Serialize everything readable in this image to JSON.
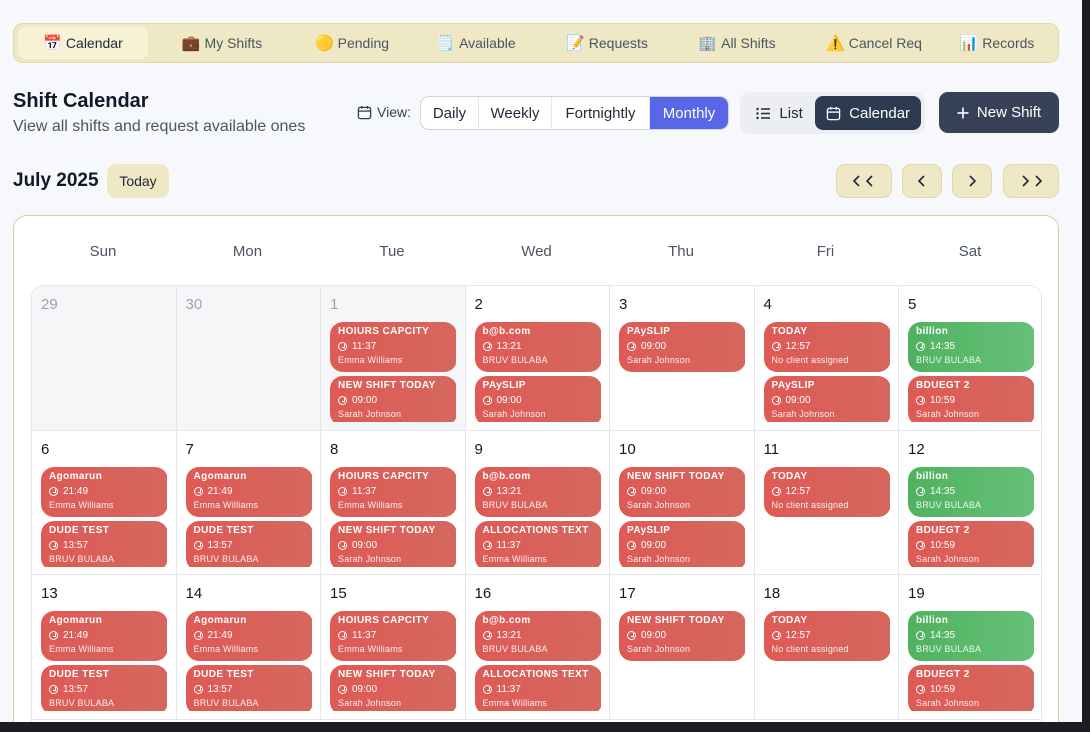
{
  "tabs": [
    {
      "icon": "📅",
      "label": "Calendar",
      "active": true
    },
    {
      "icon": "💼",
      "label": "My Shifts"
    },
    {
      "icon": "🟡",
      "label": "Pending"
    },
    {
      "icon": "🗒️",
      "label": "Available"
    },
    {
      "icon": "📝",
      "label": "Requests"
    },
    {
      "icon": "🏢",
      "label": "All Shifts"
    },
    {
      "icon": "⚠️",
      "label": "Cancel Req"
    },
    {
      "icon": "📊",
      "label": "Records"
    }
  ],
  "header": {
    "title": "Shift Calendar",
    "subtitle": "View all shifts and request available ones",
    "view_label": "View:",
    "view_options": [
      "Daily",
      "Weekly",
      "Fortnightly",
      "Monthly"
    ],
    "view_selected": "Monthly",
    "toggle": {
      "list_label": "List",
      "calendar_label": "Calendar",
      "selected": "Calendar"
    },
    "new_shift_label": "New Shift"
  },
  "month_bar": {
    "month": "July 2025",
    "today_label": "Today"
  },
  "colors": {
    "accent": "#5867e8",
    "event_red": "#de5a55",
    "event_green": "#4fb25f",
    "dark": "#374158",
    "tab_bg": "#efe8c4"
  },
  "weekdays": [
    "Sun",
    "Mon",
    "Tue",
    "Wed",
    "Thu",
    "Fri",
    "Sat"
  ],
  "weeks": [
    [
      {
        "day": "29",
        "outside": true,
        "events": []
      },
      {
        "day": "30",
        "outside": true,
        "events": []
      },
      {
        "day": "1",
        "today": true,
        "outside": true,
        "events": [
          {
            "title": "HOIURS CAPCITY",
            "time": "11:37",
            "who": "Emma Williams",
            "color": "red"
          },
          {
            "title": "NEW SHIFT TODAY",
            "time": "09:00",
            "who": "Sarah Johnson",
            "color": "red"
          }
        ]
      },
      {
        "day": "2",
        "events": [
          {
            "title": "b@b.com",
            "time": "13:21",
            "who": "BRUV BULABA",
            "color": "red"
          },
          {
            "title": "PAySLIP",
            "time": "09:00",
            "who": "Sarah Johnson",
            "color": "red"
          }
        ]
      },
      {
        "day": "3",
        "events": [
          {
            "title": "PAySLIP",
            "time": "09:00",
            "who": "Sarah Johnson",
            "color": "red"
          }
        ]
      },
      {
        "day": "4",
        "events": [
          {
            "title": "TODAY",
            "time": "12:57",
            "who": "No client assigned",
            "color": "red"
          },
          {
            "title": "PAySLIP",
            "time": "09:00",
            "who": "Sarah Johnson",
            "color": "red"
          }
        ]
      },
      {
        "day": "5",
        "events": [
          {
            "title": "billion",
            "time": "14:35",
            "who": "BRUV BULABA",
            "color": "green"
          },
          {
            "title": "BDUEGT 2",
            "time": "10:59",
            "who": "Sarah Johnson",
            "color": "red"
          }
        ]
      }
    ],
    [
      {
        "day": "6",
        "events": [
          {
            "title": "Agomarun",
            "time": "21:49",
            "who": "Emma Williams",
            "color": "red"
          },
          {
            "title": "DUDE TEST",
            "time": "13:57",
            "who": "BRUV BULABA",
            "color": "red"
          }
        ]
      },
      {
        "day": "7",
        "events": [
          {
            "title": "Agomarun",
            "time": "21:49",
            "who": "Emma Williams",
            "color": "red"
          },
          {
            "title": "DUDE TEST",
            "time": "13:57",
            "who": "BRUV BULABA",
            "color": "red"
          }
        ]
      },
      {
        "day": "8",
        "events": [
          {
            "title": "HOIURS CAPCITY",
            "time": "11:37",
            "who": "Emma Williams",
            "color": "red"
          },
          {
            "title": "NEW SHIFT TODAY",
            "time": "09:00",
            "who": "Sarah Johnson",
            "color": "red"
          }
        ]
      },
      {
        "day": "9",
        "events": [
          {
            "title": "b@b.com",
            "time": "13:21",
            "who": "BRUV BULABA",
            "color": "red"
          },
          {
            "title": "ALLOCATIONS TEXT",
            "time": "11:37",
            "who": "Emma Williams",
            "color": "red"
          }
        ]
      },
      {
        "day": "10",
        "events": [
          {
            "title": "NEW SHIFT TODAY",
            "time": "09:00",
            "who": "Sarah Johnson",
            "color": "red"
          },
          {
            "title": "PAySLIP",
            "time": "09:00",
            "who": "Sarah Johnson",
            "color": "red"
          }
        ]
      },
      {
        "day": "11",
        "events": [
          {
            "title": "TODAY",
            "time": "12:57",
            "who": "No client assigned",
            "color": "red"
          }
        ]
      },
      {
        "day": "12",
        "events": [
          {
            "title": "billion",
            "time": "14:35",
            "who": "BRUV BULABA",
            "color": "green"
          },
          {
            "title": "BDUEGT 2",
            "time": "10:59",
            "who": "Sarah Johnson",
            "color": "red"
          }
        ]
      }
    ],
    [
      {
        "day": "13",
        "events": [
          {
            "title": "Agomarun",
            "time": "21:49",
            "who": "Emma Williams",
            "color": "red"
          },
          {
            "title": "DUDE TEST",
            "time": "13:57",
            "who": "BRUV BULABA",
            "color": "red"
          }
        ]
      },
      {
        "day": "14",
        "events": [
          {
            "title": "Agomarun",
            "time": "21:49",
            "who": "Emma Williams",
            "color": "red"
          },
          {
            "title": "DUDE TEST",
            "time": "13:57",
            "who": "BRUV BULABA",
            "color": "red"
          }
        ]
      },
      {
        "day": "15",
        "events": [
          {
            "title": "HOIURS CAPCITY",
            "time": "11:37",
            "who": "Emma Williams",
            "color": "red"
          },
          {
            "title": "NEW SHIFT TODAY",
            "time": "09:00",
            "who": "Sarah Johnson",
            "color": "red"
          }
        ]
      },
      {
        "day": "16",
        "events": [
          {
            "title": "b@b.com",
            "time": "13:21",
            "who": "BRUV BULABA",
            "color": "red"
          },
          {
            "title": "ALLOCATIONS TEXT",
            "time": "11:37",
            "who": "Emma Williams",
            "color": "red"
          }
        ]
      },
      {
        "day": "17",
        "events": [
          {
            "title": "NEW SHIFT TODAY",
            "time": "09:00",
            "who": "Sarah Johnson",
            "color": "red"
          }
        ]
      },
      {
        "day": "18",
        "events": [
          {
            "title": "TODAY",
            "time": "12:57",
            "who": "No client assigned",
            "color": "red"
          }
        ]
      },
      {
        "day": "19",
        "events": [
          {
            "title": "billion",
            "time": "14:35",
            "who": "BRUV BULABA",
            "color": "green"
          },
          {
            "title": "BDUEGT 2",
            "time": "10:59",
            "who": "Sarah Johnson",
            "color": "red"
          }
        ]
      }
    ]
  ]
}
